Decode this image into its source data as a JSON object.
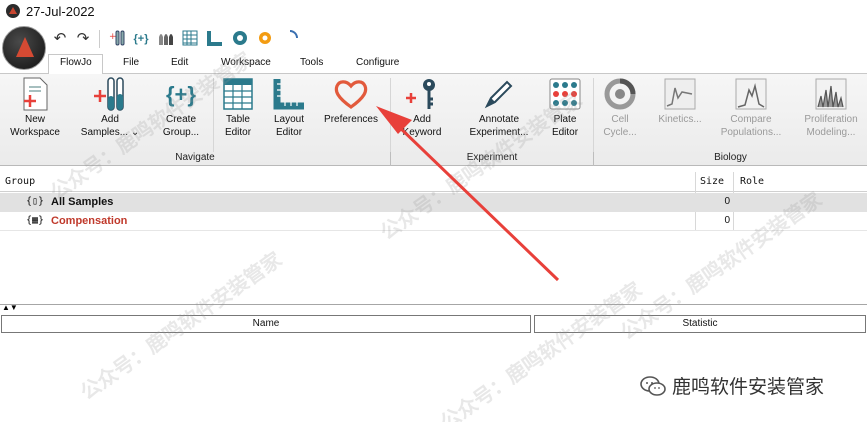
{
  "window": {
    "title": "27-Jul-2022"
  },
  "menu_tabs": [
    "FlowJo",
    "File",
    "Edit",
    "Workspace",
    "Tools",
    "Configure"
  ],
  "ribbon": {
    "navigate": {
      "label": "Navigate",
      "buttons": [
        {
          "line1": "New",
          "line2": "Workspace"
        },
        {
          "line1": "Add",
          "line2": "Samples... ⌄"
        },
        {
          "line1": "Create",
          "line2": "Group..."
        },
        {
          "line1": "Table",
          "line2": "Editor"
        },
        {
          "line1": "Layout",
          "line2": "Editor"
        },
        {
          "line1": "Preferences",
          "line2": ""
        }
      ]
    },
    "experiment": {
      "label": "Experiment",
      "buttons": [
        {
          "line1": "Add",
          "line2": "Keyword"
        },
        {
          "line1": "Annotate",
          "line2": "Experiment..."
        },
        {
          "line1": "Plate",
          "line2": "Editor"
        }
      ]
    },
    "biology": {
      "label": "Biology",
      "buttons": [
        {
          "line1": "Cell",
          "line2": "Cycle..."
        },
        {
          "line1": "Kinetics...",
          "line2": ""
        },
        {
          "line1": "Compare",
          "line2": "Populations..."
        },
        {
          "line1": "Proliferation",
          "line2": "Modeling..."
        }
      ]
    },
    "create_group_glyph": "{+}"
  },
  "sample_table": {
    "headers": {
      "group": "Group",
      "size": "Size",
      "role": "Role"
    },
    "rows": [
      {
        "icon": "{▯}",
        "name": "All Samples",
        "size": "0",
        "color": "#111111"
      },
      {
        "icon": "{▦}",
        "name": "Compensation",
        "size": "0",
        "color": "#c0392b"
      }
    ]
  },
  "stat_panel": {
    "headers": {
      "name": "Name",
      "statistic": "Statistic"
    }
  },
  "watermark": {
    "text": "公众号：鹿鸣软件安装管家",
    "brand": "鹿鸣软件安装管家"
  },
  "colors": {
    "accent_red": "#e8403a",
    "heart": "#e25a3c",
    "teal": "#2b7a8c",
    "compensation": "#c0392b"
  }
}
